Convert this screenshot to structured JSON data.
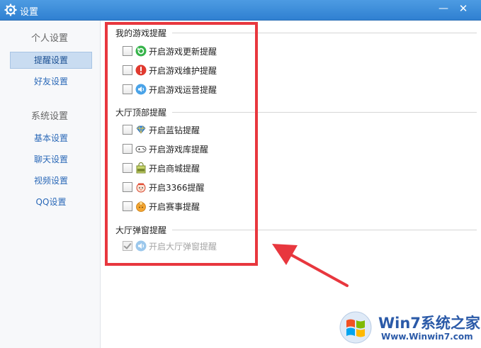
{
  "window": {
    "title": "设置",
    "title_icon": "gear-icon",
    "minimize_label": "—",
    "close_label": "✕",
    "titlebar_color": "#3a8ad8"
  },
  "sidebar": {
    "groups": [
      {
        "label": "个人设置",
        "items": [
          {
            "label": "提醒设置",
            "active": true
          },
          {
            "label": "好友设置"
          }
        ]
      },
      {
        "label": "系统设置",
        "items": [
          {
            "label": "基本设置"
          },
          {
            "label": "聊天设置"
          },
          {
            "label": "视频设置"
          },
          {
            "label": "QQ设置"
          }
        ]
      }
    ]
  },
  "sections": [
    {
      "title": "我的游戏提醒",
      "items": [
        {
          "label": "开启游戏更新提醒",
          "icon": "update-icon",
          "checked": false
        },
        {
          "label": "开启游戏维护提醒",
          "icon": "alert-icon",
          "checked": false
        },
        {
          "label": "开启游戏运营提醒",
          "icon": "speaker-icon",
          "checked": false
        }
      ]
    },
    {
      "title": "大厅顶部提醒",
      "items": [
        {
          "label": "开启蓝钻提醒",
          "icon": "blue-diamond-icon",
          "checked": false
        },
        {
          "label": "开启游戏库提醒",
          "icon": "gamepad-icon",
          "checked": false
        },
        {
          "label": "开启商城提醒",
          "icon": "shop-icon",
          "checked": false
        },
        {
          "label": "开启3366提醒",
          "icon": "3366-icon",
          "checked": false
        },
        {
          "label": "开启赛事提醒",
          "icon": "trophy-icon",
          "checked": false
        }
      ]
    },
    {
      "title": "大厅弹窗提醒",
      "items": [
        {
          "label": "开启大厅弹窗提醒",
          "icon": "speaker-icon",
          "checked": true,
          "disabled": true
        }
      ]
    }
  ],
  "annotation": {
    "highlight_color": "#e8373e"
  },
  "watermark": {
    "title": "Win7系统之家",
    "url": "Www.Winwin7.com"
  }
}
